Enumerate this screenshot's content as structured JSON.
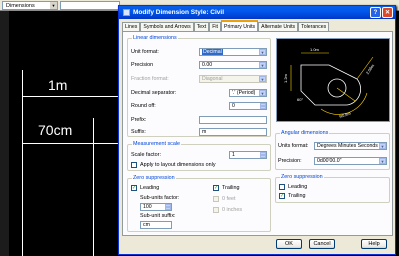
{
  "cad": {
    "toolbar_combo_value": "Dimensions",
    "label_1m": "1m",
    "label_70cm": "70cm"
  },
  "dialog": {
    "title": "Modify Dimension Style: Civil",
    "help_glyph": "?",
    "close_glyph": "✕",
    "tabs": [
      "Lines",
      "Symbols and Arrows",
      "Text",
      "Fit",
      "Primary Units",
      "Alternate Units",
      "Tolerances"
    ],
    "active_tab": "Primary Units",
    "linear": {
      "legend": "Linear dimensions",
      "unit_format_label": "Unit format:",
      "unit_format_value": "Decimal",
      "precision_label": "Precision",
      "precision_value": "0.00",
      "fraction_format_label": "Fraction format:",
      "fraction_format_value": "Diagonal",
      "decimal_sep_label": "Decimal separator:",
      "decimal_sep_value": "'.' (Period)",
      "round_off_label": "Round off:",
      "round_off_value": "0",
      "prefix_label": "Prefix:",
      "prefix_value": "",
      "suffix_label": "Suffix:",
      "suffix_value": "m"
    },
    "measurement": {
      "legend": "Measurement scale",
      "scale_factor_label": "Scale factor:",
      "scale_factor_value": "1",
      "apply_layout_label": "Apply to layout dimensions only",
      "apply_layout_checked": false
    },
    "zero_linear": {
      "legend": "Zero suppression",
      "leading_label": "Leading",
      "leading_checked": true,
      "trailing_label": "Trailing",
      "trailing_checked": true,
      "subunits_factor_label": "Sub-units factor:",
      "subunits_factor_value": "100",
      "subunit_suffix_label": "Sub-unit suffix:",
      "subunit_suffix_value": "cm",
      "feet_label": "0 feet",
      "inches_label": "0 inches"
    },
    "preview": {
      "d1": "1.0m",
      "d2": "1.2m",
      "d3": "60°",
      "d4": "R0.8m",
      "d5": "2.06m"
    },
    "angular": {
      "legend": "Angular dimensions",
      "units_format_label": "Units format:",
      "units_format_value": "Degrees Minutes Seconds",
      "precision_label": "Precision:",
      "precision_value": "0d00'00.0\""
    },
    "zero_angular": {
      "legend": "Zero suppression",
      "leading_label": "Leading",
      "leading_checked": false,
      "trailing_label": "Trailing",
      "trailing_checked": true
    },
    "buttons": {
      "ok": "OK",
      "cancel": "Cancel",
      "help": "Help"
    }
  }
}
